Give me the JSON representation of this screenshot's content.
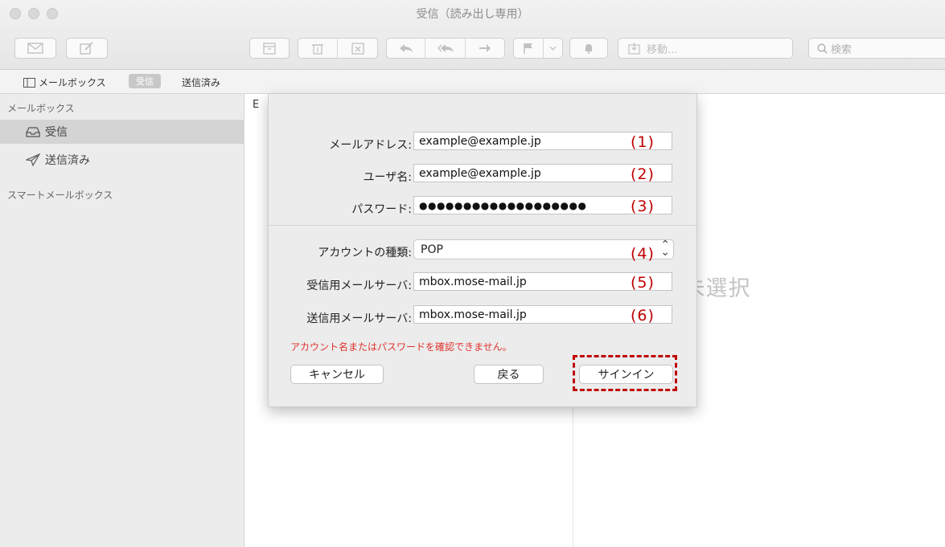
{
  "window": {
    "title": "受信（読み出し専用）"
  },
  "toolbar": {
    "move_label": "移動...",
    "search_placeholder": "検索"
  },
  "favorites": {
    "mailboxes_label": "メールボックス",
    "inbox_label": "受信",
    "sent_label": "送信済み"
  },
  "sidebar": {
    "mailboxes_header": "メールボックス",
    "items": [
      {
        "label": "受信",
        "icon": "inbox-tray-icon"
      },
      {
        "label": "送信済み",
        "icon": "paper-plane-icon"
      }
    ],
    "smart_header": "スマートメールボックス"
  },
  "list": {
    "header_partial": "E"
  },
  "viewer": {
    "no_message": "ッセージ未選択"
  },
  "dialog": {
    "email_label": "メールアドレス:",
    "email_value": "example@example.jp",
    "username_label": "ユーザ名:",
    "username_value": "example@example.jp",
    "password_label": "パスワード:",
    "password_value": "●●●●●●●●●●●●●●●●●●●",
    "account_type_label": "アカウントの種類:",
    "account_type_value": "POP",
    "incoming_label": "受信用メールサーバ:",
    "incoming_value": "mbox.mose-mail.jp",
    "outgoing_label": "送信用メールサーバ:",
    "outgoing_value": "mbox.mose-mail.jp",
    "error_message": "アカウント名またはパスワードを確認できません。",
    "cancel_label": "キャンセル",
    "back_label": "戻る",
    "signin_label": "サインイン"
  },
  "annotations": [
    "(1)",
    "(2)",
    "(3)",
    "(4)",
    "(5)",
    "(6)"
  ],
  "colors": {
    "annotation": "#c00000",
    "error": "#e0332e"
  }
}
